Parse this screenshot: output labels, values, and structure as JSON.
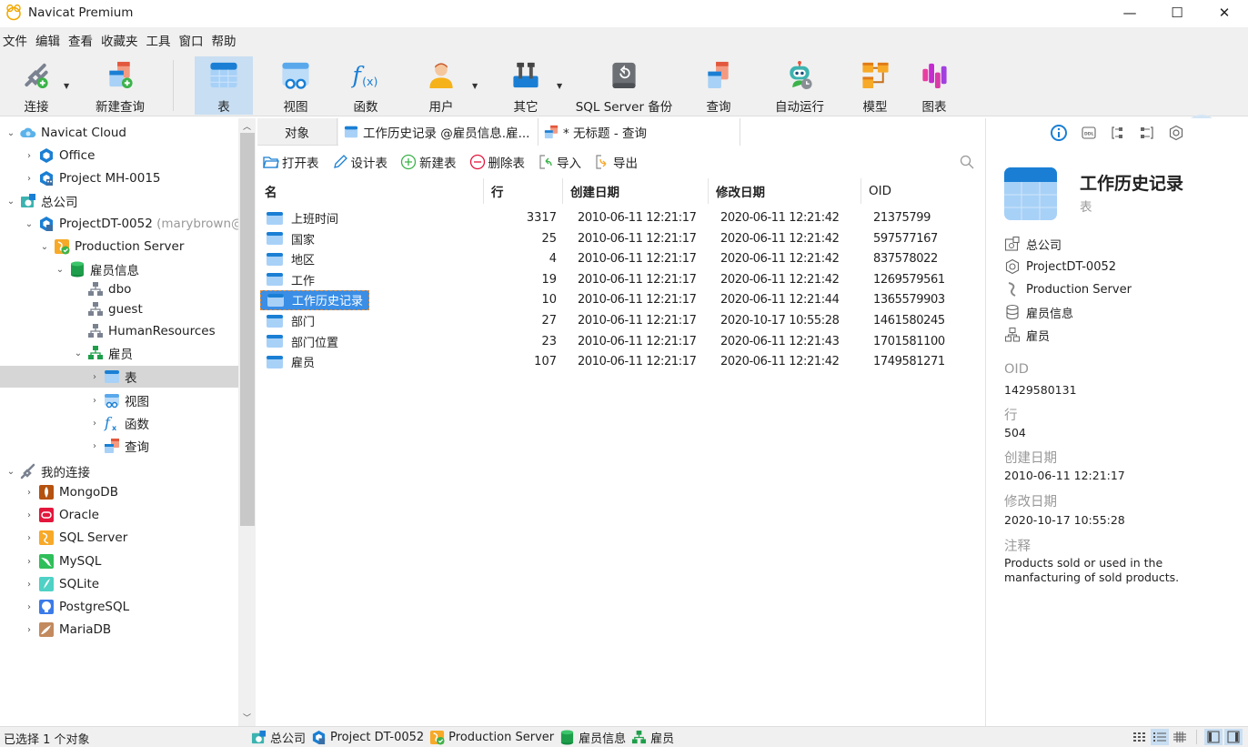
{
  "app": {
    "title": "Navicat Premium"
  },
  "window_controls": {
    "minimize": "—",
    "maximize": "☐",
    "close": "✕"
  },
  "menu": [
    "文件",
    "编辑",
    "查看",
    "收藏夹",
    "工具",
    "窗口",
    "帮助"
  ],
  "toolbar": {
    "items": [
      {
        "id": "connect",
        "label": "连接",
        "icon": "plug-add-icon",
        "dropdown": true
      },
      {
        "id": "new-query",
        "label": "新建查询",
        "icon": "new-query-icon",
        "dropdown": false
      },
      {
        "id": "table",
        "label": "表",
        "icon": "table-icon",
        "active": true
      },
      {
        "id": "view",
        "label": "视图",
        "icon": "view-icon"
      },
      {
        "id": "function",
        "label": "函数",
        "icon": "function-icon"
      },
      {
        "id": "user",
        "label": "用户",
        "icon": "user-icon",
        "dropdown": true
      },
      {
        "id": "other",
        "label": "其它",
        "icon": "tools-icon",
        "dropdown": true
      },
      {
        "id": "backup",
        "label": "SQL Server 备份",
        "icon": "backup-icon"
      },
      {
        "id": "query",
        "label": "查询",
        "icon": "query-icon"
      },
      {
        "id": "automation",
        "label": "自动运行",
        "icon": "robot-icon"
      },
      {
        "id": "model",
        "label": "模型",
        "icon": "model-icon"
      },
      {
        "id": "chart",
        "label": "图表",
        "icon": "chart-icon"
      }
    ]
  },
  "sidebar": {
    "items": [
      {
        "label": "Navicat Cloud",
        "level": 0,
        "expanded": true,
        "icon": "cloud-icon"
      },
      {
        "label": "Office",
        "level": 1,
        "expanded": false,
        "icon": "project-icon"
      },
      {
        "label": "Project MH-0015",
        "level": 1,
        "expanded": false,
        "icon": "project-shared-icon"
      },
      {
        "label": "总公司",
        "level": 0,
        "expanded": true,
        "icon": "company-icon"
      },
      {
        "label": "ProjectDT-0052",
        "suffix": "(marybrown@",
        "level": 1,
        "expanded": true,
        "icon": "project-shared-icon"
      },
      {
        "label": "Production Server",
        "level": 2,
        "expanded": true,
        "icon": "sqlserver-connected-icon"
      },
      {
        "label": "雇员信息",
        "level": 3,
        "expanded": true,
        "icon": "database-icon"
      },
      {
        "label": "dbo",
        "level": 4,
        "icon": "schema-icon"
      },
      {
        "label": "guest",
        "level": 4,
        "icon": "schema-icon"
      },
      {
        "label": "HumanResources",
        "level": 4,
        "icon": "schema-icon"
      },
      {
        "label": "雇员",
        "level": 4,
        "expanded": true,
        "icon": "schema-active-icon"
      },
      {
        "label": "表",
        "level": 5,
        "expanded": false,
        "icon": "table-icon",
        "selected": true
      },
      {
        "label": "视图",
        "level": 5,
        "expanded": false,
        "icon": "view-icon"
      },
      {
        "label": "函数",
        "level": 5,
        "expanded": false,
        "icon": "function-icon"
      },
      {
        "label": "查询",
        "level": 5,
        "expanded": false,
        "icon": "query-icon"
      },
      {
        "label": "我的连接",
        "level": 0,
        "expanded": true,
        "icon": "connection-icon"
      },
      {
        "label": "MongoDB",
        "level": 1,
        "expanded": false,
        "icon": "mongodb-icon"
      },
      {
        "label": "Oracle",
        "level": 1,
        "expanded": false,
        "icon": "oracle-icon"
      },
      {
        "label": "SQL Server",
        "level": 1,
        "expanded": false,
        "icon": "sqlserver-icon"
      },
      {
        "label": "MySQL",
        "level": 1,
        "expanded": false,
        "icon": "mysql-icon"
      },
      {
        "label": "SQLite",
        "level": 1,
        "expanded": false,
        "icon": "sqlite-icon"
      },
      {
        "label": "PostgreSQL",
        "level": 1,
        "expanded": false,
        "icon": "postgresql-icon"
      },
      {
        "label": "MariaDB",
        "level": 1,
        "expanded": false,
        "icon": "mariadb-icon"
      }
    ]
  },
  "tabs": [
    {
      "label": "对象",
      "active": true
    },
    {
      "label": "工作历史记录 @雇员信息.雇...",
      "icon": "table-icon"
    },
    {
      "label": "* 无标题 - 查询",
      "icon": "query-icon"
    }
  ],
  "object_toolbar": [
    {
      "label": "打开表",
      "icon": "folder-open-icon"
    },
    {
      "label": "设计表",
      "icon": "pencil-icon"
    },
    {
      "label": "新建表",
      "icon": "plus-circle-icon"
    },
    {
      "label": "删除表",
      "icon": "minus-circle-icon"
    },
    {
      "label": "导入",
      "icon": "import-icon"
    },
    {
      "label": "导出",
      "icon": "export-icon"
    }
  ],
  "table": {
    "columns": [
      "名",
      "行",
      "创建日期",
      "修改日期",
      "OID"
    ],
    "rows": [
      {
        "name": "上班时间",
        "rows": "3317",
        "created": "2010-06-11 12:21:17",
        "modified": "2020-06-11 12:21:42",
        "oid": "21375799"
      },
      {
        "name": "国家",
        "rows": "25",
        "created": "2010-06-11 12:21:17",
        "modified": "2020-06-11 12:21:42",
        "oid": "597577167"
      },
      {
        "name": "地区",
        "rows": "4",
        "created": "2010-06-11 12:21:17",
        "modified": "2020-06-11 12:21:42",
        "oid": "837578022"
      },
      {
        "name": "工作",
        "rows": "19",
        "created": "2010-06-11 12:21:17",
        "modified": "2020-06-11 12:21:42",
        "oid": "1269579561"
      },
      {
        "name": "工作历史记录",
        "rows": "10",
        "created": "2010-06-11 12:21:17",
        "modified": "2020-06-11 12:21:44",
        "oid": "1365579903",
        "selected": true
      },
      {
        "name": "部门",
        "rows": "27",
        "created": "2010-06-11 12:21:17",
        "modified": "2020-10-17 10:55:28",
        "oid": "1461580245"
      },
      {
        "name": "部门位置",
        "rows": "23",
        "created": "2010-06-11 12:21:17",
        "modified": "2020-06-11 12:21:43",
        "oid": "1701581100"
      },
      {
        "name": "雇员",
        "rows": "107",
        "created": "2010-06-11 12:21:17",
        "modified": "2020-06-11 12:21:42",
        "oid": "1749581271"
      }
    ]
  },
  "info_panel": {
    "tab_icons": [
      "info-icon",
      "ddl-icon",
      "dependency-icon",
      "relation-icon",
      "hexagon-icon"
    ],
    "title": "工作历史记录",
    "type": "表",
    "path": [
      {
        "label": "总公司",
        "icon": "company-icon"
      },
      {
        "label": "ProjectDT-0052",
        "icon": "project-icon"
      },
      {
        "label": "Production Server",
        "icon": "server-icon"
      },
      {
        "label": "雇员信息",
        "icon": "database-icon"
      },
      {
        "label": "雇员",
        "icon": "schema-icon"
      }
    ],
    "props": [
      {
        "label": "OID",
        "value": "1429580131"
      },
      {
        "label": "行",
        "value": "504"
      },
      {
        "label": "创建日期",
        "value": "2010-06-11 12:21:17"
      },
      {
        "label": "修改日期",
        "value": "2020-10-17 10:55:28"
      },
      {
        "label": "注释",
        "value": "Products sold or used in the manfacturing of sold products."
      }
    ]
  },
  "statusbar": {
    "selection": "已选择 1 个对象",
    "crumbs": [
      {
        "label": "总公司",
        "icon": "company-icon"
      },
      {
        "label": "Project DT-0052",
        "icon": "project-shared-icon"
      },
      {
        "label": "Production Server",
        "icon": "sqlserver-connected-icon"
      },
      {
        "label": "雇员信息",
        "icon": "database-icon"
      },
      {
        "label": "雇员",
        "icon": "schema-icon"
      }
    ],
    "view_modes": [
      "list-view-icon",
      "detail-view-icon",
      "grid-view-icon"
    ],
    "active_view": "detail-view-icon"
  },
  "colors": {
    "accent": "#1a7fd4",
    "selection": "#3a8ee6",
    "toolbar_active": "#c8def2"
  }
}
